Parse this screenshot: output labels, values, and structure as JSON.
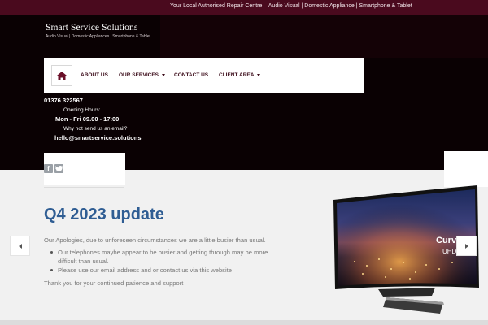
{
  "topbar": {
    "tagline": "Your Local Authorised Repair Centre – Audio Visual | Domestic Appliance | Smartphone & Tablet"
  },
  "logo": {
    "title": "Smart Service Solutions",
    "subtitle": "Audio Visual | Domestic Appliances | Smartphone & Tablet"
  },
  "nav": {
    "home_icon": "home-icon",
    "items": [
      {
        "label": "ABOUT US",
        "dropdown": false
      },
      {
        "label": "OUR SERVICES",
        "dropdown": true
      },
      {
        "label": "CONTACT US",
        "dropdown": false
      },
      {
        "label": "CLIENT AREA",
        "dropdown": true
      }
    ]
  },
  "contact": {
    "phone": "01376 322567",
    "hours_label": "Opening Hours:",
    "hours": "Mon - Fri 09.00 - 17:00",
    "email_prompt": "Why not send us an email?",
    "email": "hello@smartservice.solutions"
  },
  "social": {
    "icons": [
      "facebook-icon",
      "twitter-icon"
    ]
  },
  "slide": {
    "headline": "Q4 2023 update",
    "intro": "Our Apologies, due to unforeseen circumstances we are a little busier than usual.",
    "bullets": [
      "Our telephones maybe appear to be busier and getting through may be more difficult than usual.",
      "Please use  our email address and or contact us via this website"
    ],
    "outro": "Thank you for your continued patience and support",
    "tv_screen_text": "Curv",
    "tv_screen_subtext": "UHD"
  },
  "slider_controls": {
    "prev_icon": "chevron-left-icon",
    "next_icon": "chevron-right-icon"
  },
  "colors": {
    "topbar": "#4a0a1e",
    "hero": "#0a0103",
    "headline": "#2f5d93",
    "nav_text": "#3a0a18"
  }
}
